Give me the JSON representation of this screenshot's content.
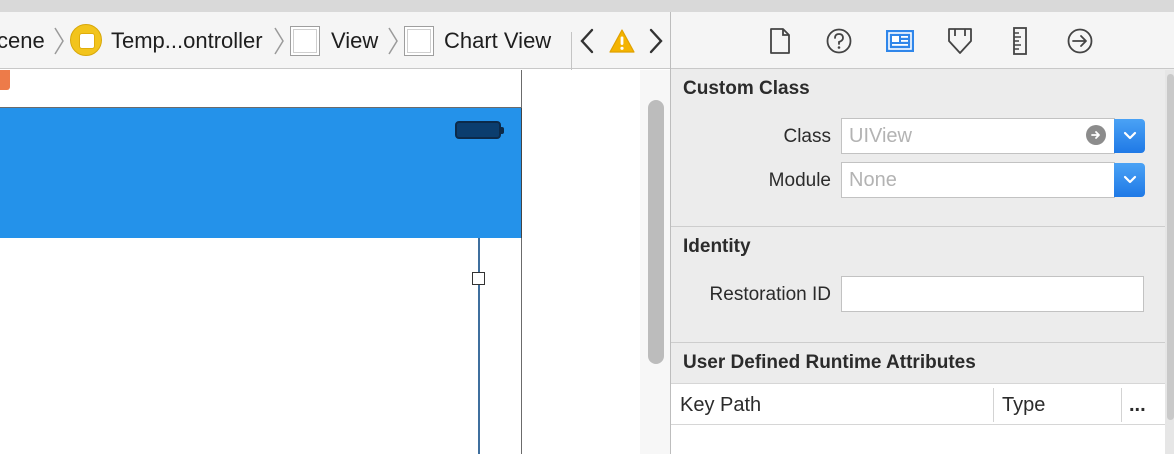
{
  "breadcrumb": {
    "items": [
      {
        "label": "cene"
      },
      {
        "label": "Temp...ontroller",
        "icon": "view-controller-icon"
      },
      {
        "label": "View",
        "icon": "view-icon"
      },
      {
        "label": "Chart View",
        "icon": "view-icon"
      }
    ],
    "nav": {
      "back": "‹",
      "forward": "›",
      "warning": "!"
    }
  },
  "inspector": {
    "tabs": [
      {
        "name": "file-inspector-icon"
      },
      {
        "name": "quick-help-icon"
      },
      {
        "name": "identity-inspector-icon",
        "active": true
      },
      {
        "name": "attributes-inspector-icon"
      },
      {
        "name": "size-inspector-icon"
      },
      {
        "name": "connections-inspector-icon"
      }
    ],
    "custom_class": {
      "title": "Custom Class",
      "class_label": "Class",
      "class_placeholder": "UIView",
      "module_label": "Module",
      "module_placeholder": "None"
    },
    "identity": {
      "title": "Identity",
      "restoration_label": "Restoration ID",
      "restoration_value": ""
    },
    "runtime_attributes": {
      "title": "User Defined Runtime Attributes",
      "columns": [
        "Key Path",
        "Type",
        "..."
      ]
    }
  },
  "colors": {
    "navbar": "#2492ea",
    "accent": "#2f86ea",
    "scene_icon": "#f2c41c",
    "warning": "#f4b400"
  }
}
